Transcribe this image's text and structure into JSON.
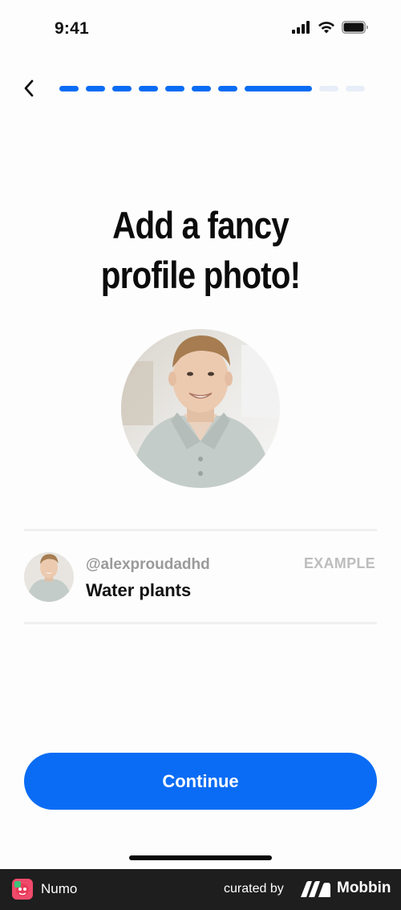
{
  "status_bar": {
    "time": "9:41",
    "icons": [
      "cellular-signal-icon",
      "wifi-icon",
      "battery-icon"
    ]
  },
  "header": {
    "back_icon": "chevron-left-icon",
    "progress": {
      "total_steps": 10,
      "completed_steps": 8,
      "active_color": "#0A6CF4",
      "inactive_color": "#E8EEF8"
    }
  },
  "main": {
    "title_line1": "Add a fancy",
    "title_line2": "profile photo!",
    "profile_photo": "profile-photo"
  },
  "example_card": {
    "username": "@alexproudadhd",
    "task": "Water plants",
    "badge": "EXAMPLE"
  },
  "actions": {
    "continue_label": "Continue",
    "continue_color": "#0A6CF4"
  },
  "footer": {
    "app_name": "Numo",
    "curated_by": "curated by",
    "brand": "Mobbin"
  }
}
